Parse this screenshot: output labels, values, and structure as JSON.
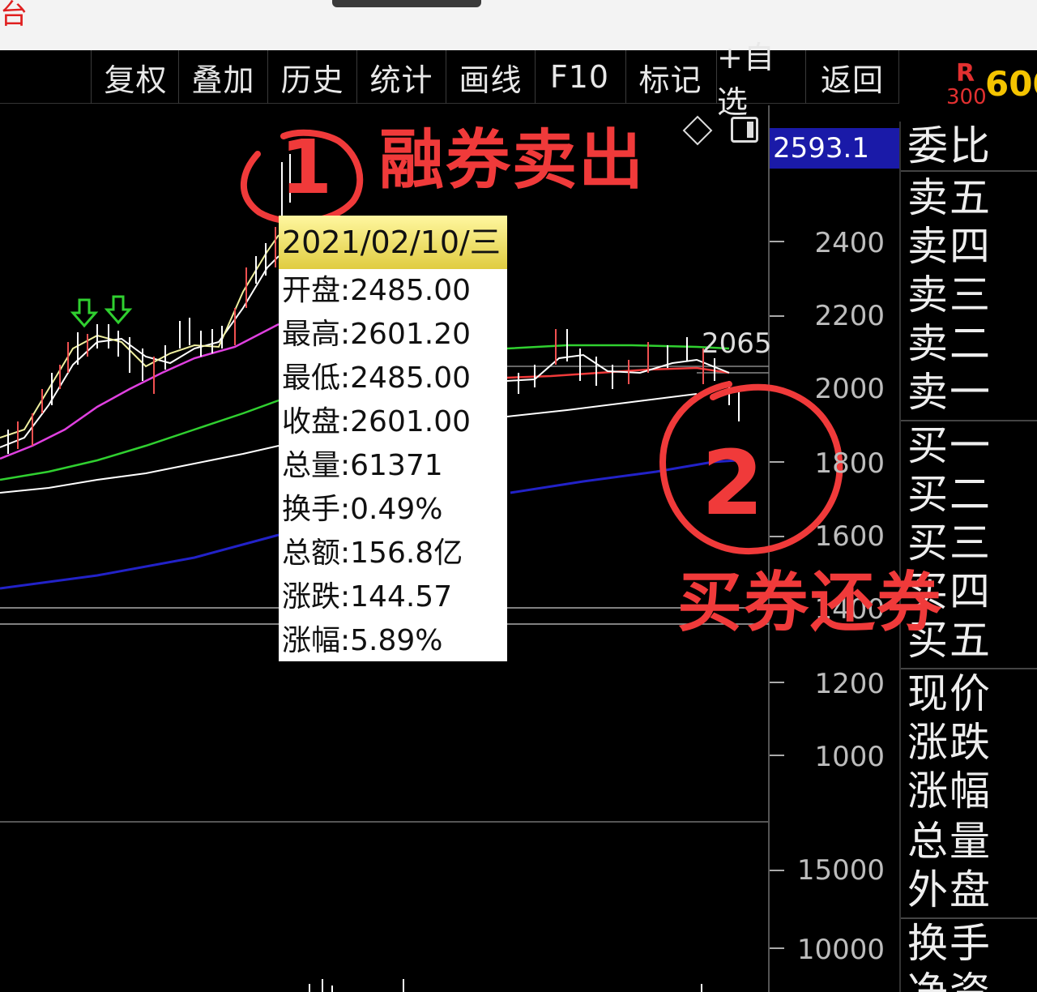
{
  "title_bar": {
    "char": "台"
  },
  "toolbar": {
    "items": [
      "复权",
      "叠加",
      "历史",
      "统计",
      "画线",
      "F10",
      "标记",
      "+自选",
      "返回"
    ]
  },
  "stock_code": {
    "r": "R",
    "n300": "300",
    "code": "600"
  },
  "chart": {
    "current_price_label": "2593.1",
    "axis_ticks": [
      "2400",
      "2200",
      "2000",
      "1800",
      "1600",
      "1400",
      "1200",
      "1000",
      "15000",
      "10000"
    ],
    "peak_label": "2065"
  },
  "tooltip": {
    "date": "2021/02/10/三",
    "rows": [
      "开盘:2485.00",
      "最高:2601.20",
      "最低:2485.00",
      "收盘:2601.00",
      "总量:61371",
      "换手:0.49%",
      "总额:156.8亿",
      "涨跌:144.57",
      "涨幅:5.89%"
    ]
  },
  "right_panel": {
    "labels": [
      "委比",
      "卖五",
      "卖四",
      "卖三",
      "卖二",
      "卖一",
      "买一",
      "买二",
      "买三",
      "买四",
      "买五",
      "现价",
      "涨跌",
      "涨幅",
      "总量",
      "外盘",
      "换手",
      "净资"
    ]
  },
  "annotations": {
    "sell_short": "融券卖出",
    "buy_cover": "买券还券",
    "circle_1": "1",
    "circle_2": "2"
  },
  "colors": {
    "annotation_red": "#f03a3a",
    "ma5": "#ffffff",
    "ma10": "#f0f000",
    "ma20": "#e040e0",
    "ma30": "#30d030",
    "ma60": "#ffffff",
    "ma120": "#2020c0",
    "price_label_bg": "#1a1aa8",
    "code_yellow": "#f4c400"
  }
}
